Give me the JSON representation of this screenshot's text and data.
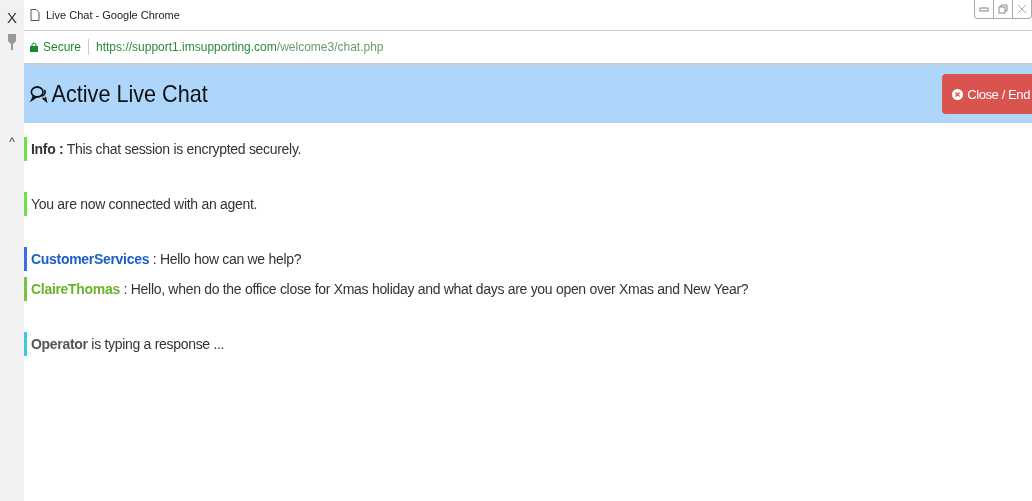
{
  "side_strip": {
    "close_glyph": "X",
    "scroll_glyph": "^"
  },
  "window": {
    "title": "Live Chat - Google Chrome"
  },
  "address_bar": {
    "secure_label": "Secure",
    "url_host": "https://support1.imsupporting.com",
    "url_path": "/welcome3/chat.php"
  },
  "header": {
    "title": "Active Live Chat",
    "close_button": "Close / End"
  },
  "messages": [
    {
      "kind": "info",
      "sender": "Info :",
      "text": "This chat session is encrypted securely.",
      "color": "#6ee04a"
    },
    {
      "kind": "system",
      "text": "You are now connected with an agent.",
      "color": "#6ee04a"
    },
    {
      "kind": "agent",
      "sender": "CustomerServices",
      "text": ": Hello how can we help?",
      "color": "#3d6ce8"
    },
    {
      "kind": "customer",
      "sender": "ClaireThomas",
      "text": ": Hello, when do the office close for Xmas holiday and what days are you open over Xmas and New Year?",
      "color": "#7ac143"
    },
    {
      "kind": "typing",
      "sender": "Operator",
      "text": "is typing a response ...",
      "color": "#3cc8e0"
    }
  ]
}
